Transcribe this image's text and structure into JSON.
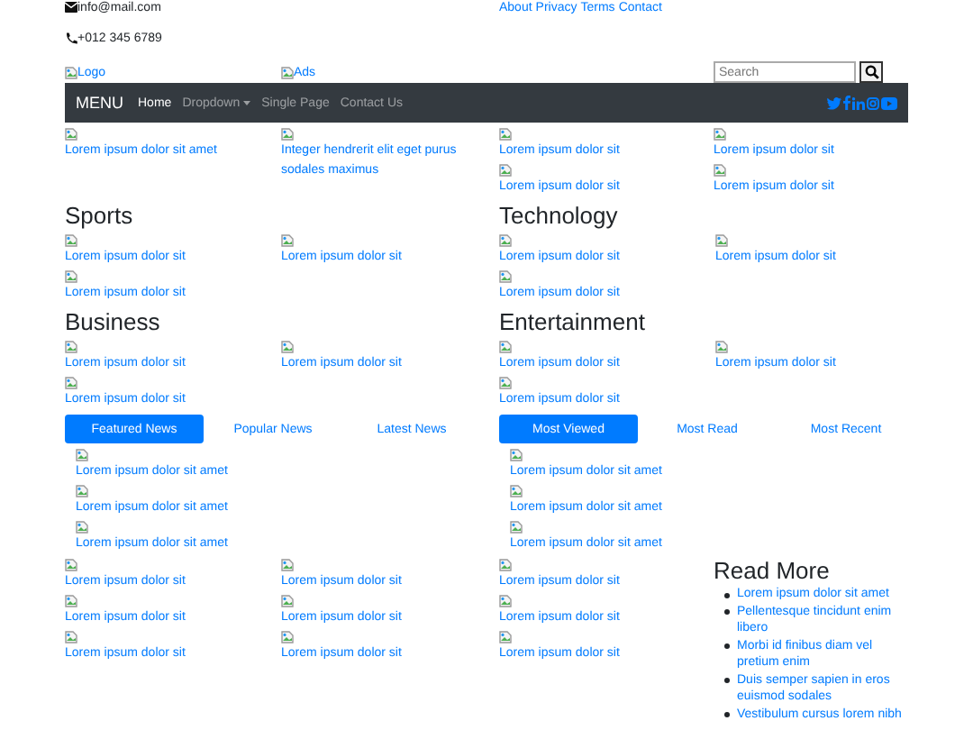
{
  "contact": {
    "email": "info@mail.com",
    "phone": "+012 345 6789"
  },
  "top_links": [
    "About",
    "Privacy",
    "Terms",
    "Contact"
  ],
  "logo_alt": "Logo",
  "ads_alt": "Ads",
  "search": {
    "placeholder": "Search"
  },
  "navbar": {
    "brand": "MENU",
    "items": [
      {
        "label": "Home",
        "kind": "link",
        "selected": true
      },
      {
        "label": "Dropdown",
        "kind": "dropdown",
        "selected": false
      },
      {
        "label": "Single Page",
        "kind": "link",
        "selected": false
      },
      {
        "label": "Contact Us",
        "kind": "link",
        "selected": false
      }
    ]
  },
  "featured_columns": [
    [
      "Lorem ipsum dolor sit amet"
    ],
    [
      "Integer hendrerit elit eget purus sodales maximus"
    ],
    [
      "Lorem ipsum dolor sit",
      "Lorem ipsum dolor sit"
    ],
    [
      "Lorem ipsum dolor sit",
      "Lorem ipsum dolor sit"
    ]
  ],
  "sections": [
    {
      "title": "Sports",
      "items": [
        "Lorem ipsum dolor sit",
        "Lorem ipsum dolor sit",
        "Lorem ipsum dolor sit"
      ]
    },
    {
      "title": "Technology",
      "items": [
        "Lorem ipsum dolor sit",
        "Lorem ipsum dolor sit",
        "Lorem ipsum dolor sit"
      ]
    },
    {
      "title": "Business",
      "items": [
        "Lorem ipsum dolor sit",
        "Lorem ipsum dolor sit",
        "Lorem ipsum dolor sit"
      ]
    },
    {
      "title": "Entertainment",
      "items": [
        "Lorem ipsum dolor sit",
        "Lorem ipsum dolor sit",
        "Lorem ipsum dolor sit"
      ]
    }
  ],
  "tab_groups": [
    {
      "tabs": [
        {
          "label": "Featured News",
          "selected": true
        },
        {
          "label": "Popular News",
          "selected": false
        },
        {
          "label": "Latest News",
          "selected": false
        }
      ],
      "items": [
        "Lorem ipsum dolor sit amet",
        "Lorem ipsum dolor sit amet",
        "Lorem ipsum dolor sit amet"
      ]
    },
    {
      "tabs": [
        {
          "label": "Most Viewed",
          "selected": true
        },
        {
          "label": "Most Read",
          "selected": false
        },
        {
          "label": "Most Recent",
          "selected": false
        }
      ],
      "items": [
        "Lorem ipsum dolor sit amet",
        "Lorem ipsum dolor sit amet",
        "Lorem ipsum dolor sit amet"
      ]
    }
  ],
  "bottom_columns": [
    [
      "Lorem ipsum dolor sit",
      "Lorem ipsum dolor sit",
      "Lorem ipsum dolor sit"
    ],
    [
      "Lorem ipsum dolor sit",
      "Lorem ipsum dolor sit",
      "Lorem ipsum dolor sit"
    ],
    [
      "Lorem ipsum dolor sit",
      "Lorem ipsum dolor sit",
      "Lorem ipsum dolor sit"
    ]
  ],
  "read_more": {
    "title": "Read More",
    "items": [
      "Lorem ipsum dolor sit amet",
      "Pellentesque tincidunt enim libero",
      "Morbi id finibus diam vel pretium enim",
      "Duis semper sapien in eros euismod sodales",
      "Vestibulum cursus lorem nibh"
    ]
  }
}
